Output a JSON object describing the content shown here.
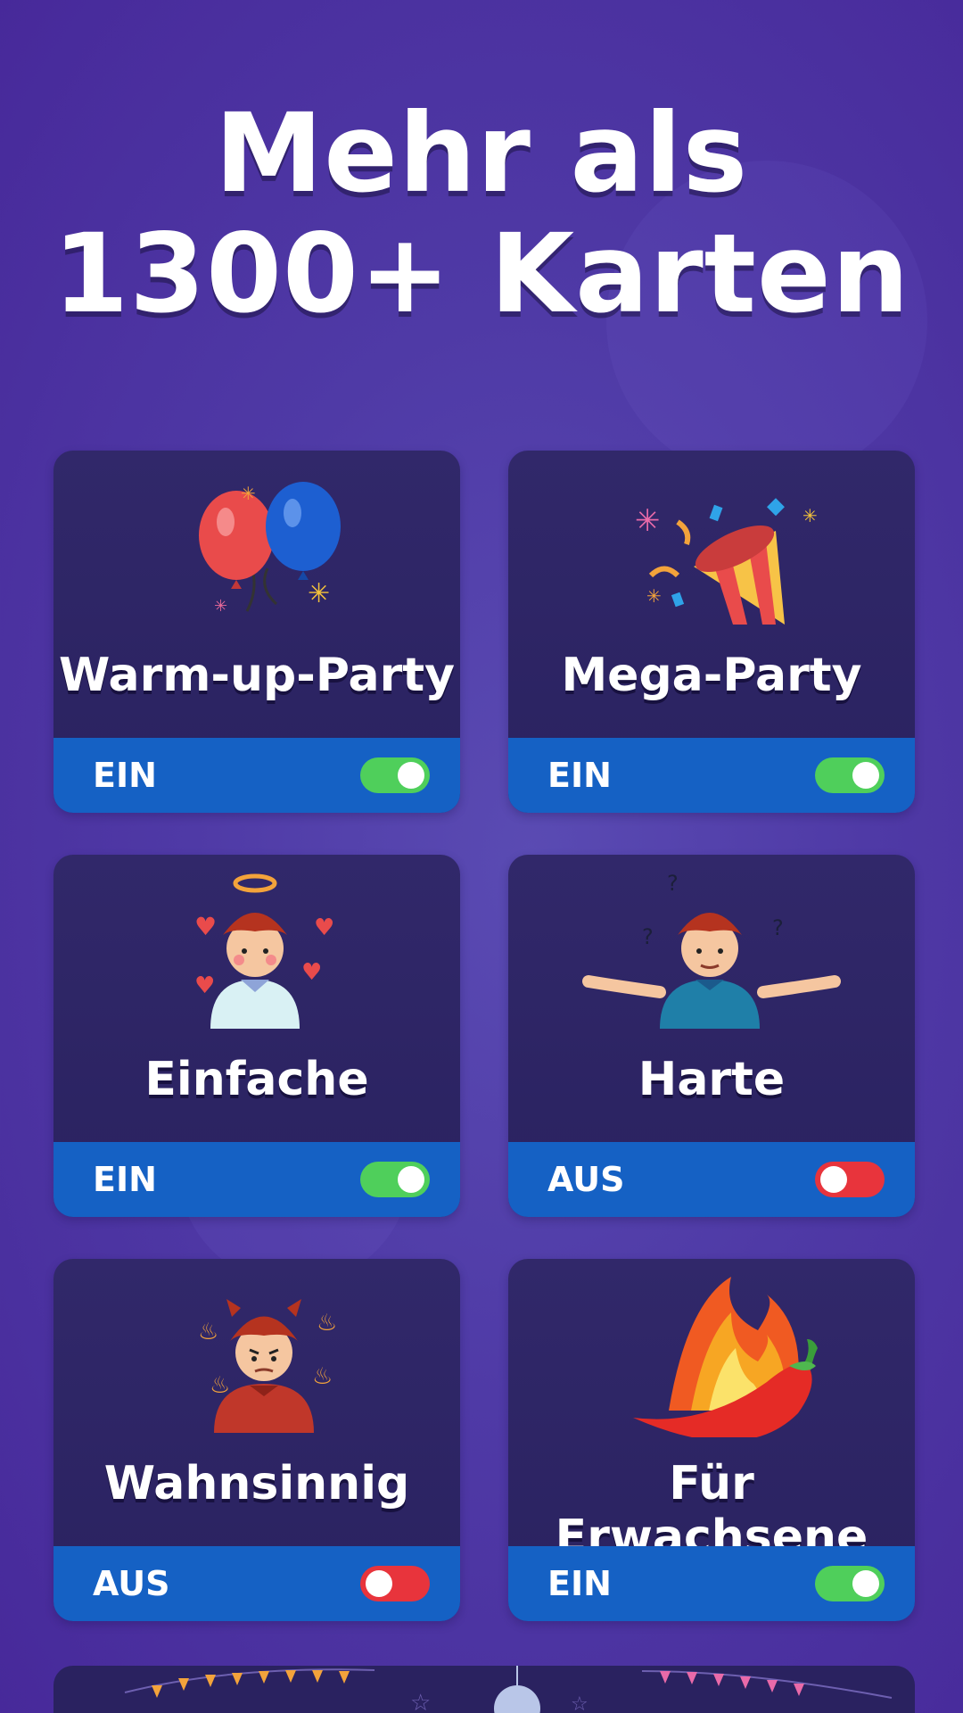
{
  "headline": {
    "line1": "Mehr als",
    "line2": "1300+ Karten"
  },
  "cards": [
    {
      "title": "Warm-up-Party",
      "state": "EIN",
      "enabled": true,
      "icon": "balloons-icon"
    },
    {
      "title": "Mega-Party",
      "state": "EIN",
      "enabled": true,
      "icon": "party-popper-icon"
    },
    {
      "title": "Einfache",
      "state": "EIN",
      "enabled": true,
      "icon": "angel-character-icon"
    },
    {
      "title": "Harte",
      "state": "AUS",
      "enabled": false,
      "icon": "confused-character-icon"
    },
    {
      "title": "Wahnsinnig",
      "state": "AUS",
      "enabled": false,
      "icon": "devil-character-icon"
    },
    {
      "title": "Für Erwachsene",
      "state": "EIN",
      "enabled": true,
      "icon": "hot-pepper-icon"
    }
  ],
  "colors": {
    "on": "#4fcf5b",
    "off": "#e8343c",
    "bar": "#1561c4",
    "card": "#2a2260"
  }
}
